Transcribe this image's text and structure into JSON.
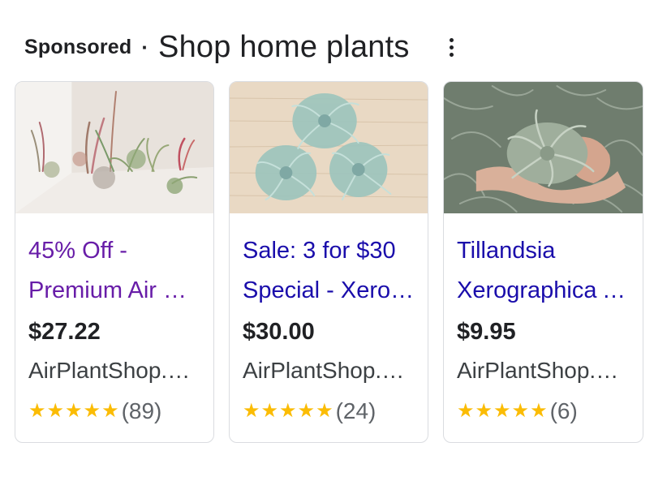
{
  "header": {
    "sponsored": "Sponsored",
    "separator": "·",
    "title": "Shop home plants"
  },
  "colors": {
    "visited_link": "#681da8",
    "link": "#1a0dab",
    "star": "#fbbc04"
  },
  "cards": [
    {
      "title_line1": "45% Off -",
      "title_line2": "Premium Air Plants",
      "price": "$27.22",
      "merchant": "AirPlantShop.com",
      "stars": "★★★★★",
      "rating_count": "(89)",
      "image": "air-plants-on-window-ledge"
    },
    {
      "title_line1": "Sale: 3 for $30",
      "title_line2": "Special - Xerographica",
      "price": "$30.00",
      "merchant": "AirPlantShop.com",
      "stars": "★★★★★",
      "rating_count": "(24)",
      "image": "three-xerographica-on-wood"
    },
    {
      "title_line1": "Tillandsia",
      "title_line2": "Xerographica Air Plant",
      "price": "$9.95",
      "merchant": "AirPlantShop.com",
      "stars": "★★★★★",
      "rating_count": "(6)",
      "image": "xerographica-held-in-hands"
    }
  ]
}
